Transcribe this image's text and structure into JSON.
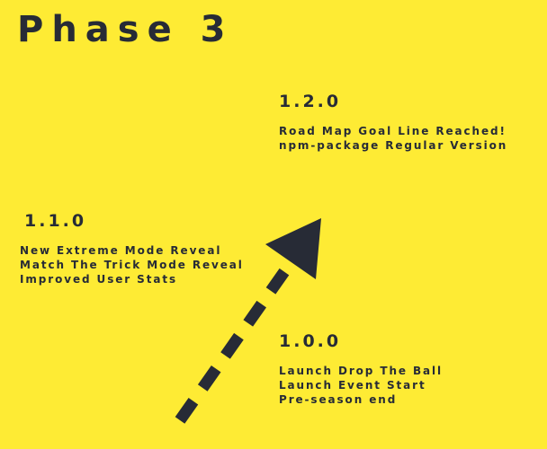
{
  "title": "Phase 3",
  "colors": {
    "background": "#FEEB34",
    "text": "#272B36"
  },
  "milestones": [
    {
      "version": "1.2.0",
      "items": [
        "Road Map Goal Line Reached!",
        "npm-package Regular Version"
      ]
    },
    {
      "version": "1.1.0",
      "items": [
        "New Extreme Mode Reveal",
        "Match The Trick Mode Reveal",
        "Improved User Stats"
      ]
    },
    {
      "version": "1.0.0",
      "items": [
        "Launch Drop The Ball",
        "Launch Event Start",
        "Pre-season end"
      ]
    }
  ],
  "arrow_icon": "dashed-arrow-up-right"
}
